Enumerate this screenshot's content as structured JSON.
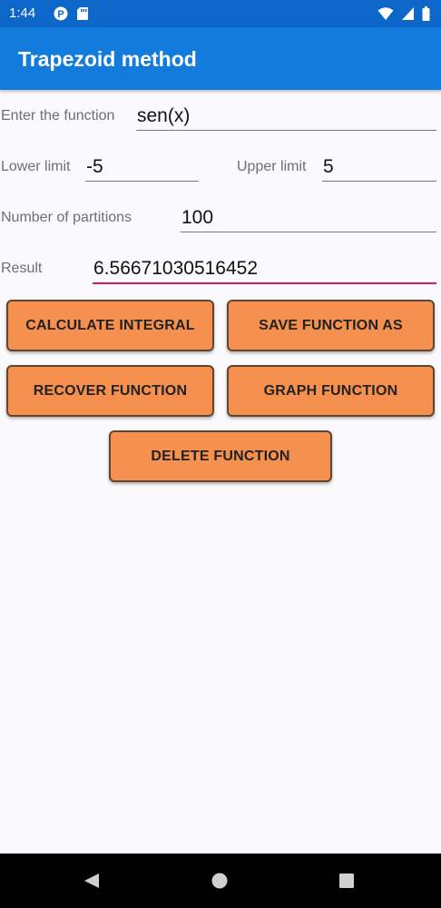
{
  "status": {
    "time": "1:44"
  },
  "app": {
    "title": "Trapezoid method"
  },
  "form": {
    "function_label": "Enter the function",
    "function_value": "sen(x)",
    "lower_label": "Lower limit",
    "lower_value": "-5",
    "upper_label": "Upper limit",
    "upper_value": "5",
    "partitions_label": "Number of partitions",
    "partitions_value": "100",
    "result_label": "Result",
    "result_value": "6.56671030516452"
  },
  "buttons": {
    "calculate": "CALCULATE INTEGRAL",
    "save": "SAVE FUNCTION AS",
    "recover": "RECOVER FUNCTION",
    "graph": "GRAPH FUNCTION",
    "delete": "DELETE FUNCTION"
  },
  "icons": {
    "status_left": [
      "p-badge-icon",
      "sd-card-icon"
    ],
    "status_right": [
      "wifi-icon",
      "cell-signal-icon",
      "battery-icon"
    ],
    "nav": [
      "back-icon",
      "home-icon",
      "recents-icon"
    ]
  },
  "colors": {
    "status_bar": "#0d67c9",
    "app_bar": "#127bdb",
    "button": "#f5904e",
    "active_underline": "#d81b60"
  }
}
